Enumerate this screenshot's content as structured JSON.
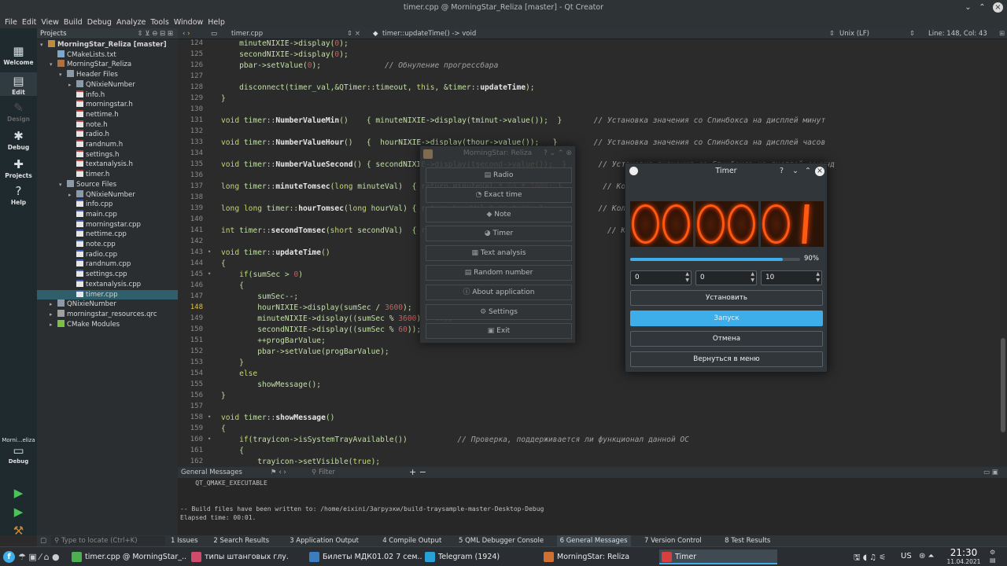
{
  "window_title": "timer.cpp @ MorningStar_Reliza [master] - Qt Creator",
  "menu": [
    "File",
    "Edit",
    "View",
    "Build",
    "Debug",
    "Analyze",
    "Tools",
    "Window",
    "Help"
  ],
  "modes": [
    {
      "label": "Welcome",
      "icon": "grid-icon"
    },
    {
      "label": "Edit",
      "icon": "edit-icon"
    },
    {
      "label": "Design",
      "icon": "pencil-icon"
    },
    {
      "label": "Debug",
      "icon": "bug-icon"
    },
    {
      "label": "Projects",
      "icon": "wrench-icon"
    },
    {
      "label": "Help",
      "icon": "help-icon"
    }
  ],
  "kit": {
    "name": "Morni...eliza",
    "mode": "Debug"
  },
  "project_panel": {
    "title": "Projects",
    "tree": [
      {
        "label": "MorningStar_Reliza [master]",
        "level": 0,
        "arrow": "▾",
        "type": "project"
      },
      {
        "label": "CMakeLists.txt",
        "level": 1,
        "arrow": "",
        "type": "file"
      },
      {
        "label": "MorningStar_Reliza",
        "level": 1,
        "arrow": "▾",
        "type": "target"
      },
      {
        "label": "Header Files",
        "level": 2,
        "arrow": "▾",
        "type": "folder"
      },
      {
        "label": "QNixieNumber",
        "level": 3,
        "arrow": "▸",
        "type": "folder"
      },
      {
        "label": "info.h",
        "level": 3,
        "arrow": "",
        "type": "h"
      },
      {
        "label": "morningstar.h",
        "level": 3,
        "arrow": "",
        "type": "h"
      },
      {
        "label": "nettime.h",
        "level": 3,
        "arrow": "",
        "type": "h"
      },
      {
        "label": "note.h",
        "level": 3,
        "arrow": "",
        "type": "h"
      },
      {
        "label": "radio.h",
        "level": 3,
        "arrow": "",
        "type": "h"
      },
      {
        "label": "randnum.h",
        "level": 3,
        "arrow": "",
        "type": "h"
      },
      {
        "label": "settings.h",
        "level": 3,
        "arrow": "",
        "type": "h"
      },
      {
        "label": "textanalysis.h",
        "level": 3,
        "arrow": "",
        "type": "h"
      },
      {
        "label": "timer.h",
        "level": 3,
        "arrow": "",
        "type": "h"
      },
      {
        "label": "Source Files",
        "level": 2,
        "arrow": "▾",
        "type": "folder"
      },
      {
        "label": "QNixieNumber",
        "level": 3,
        "arrow": "▸",
        "type": "folder"
      },
      {
        "label": "info.cpp",
        "level": 3,
        "arrow": "",
        "type": "cpp"
      },
      {
        "label": "main.cpp",
        "level": 3,
        "arrow": "",
        "type": "cpp"
      },
      {
        "label": "morningstar.cpp",
        "level": 3,
        "arrow": "",
        "type": "cpp"
      },
      {
        "label": "nettime.cpp",
        "level": 3,
        "arrow": "",
        "type": "cpp"
      },
      {
        "label": "note.cpp",
        "level": 3,
        "arrow": "",
        "type": "cpp"
      },
      {
        "label": "radio.cpp",
        "level": 3,
        "arrow": "",
        "type": "cpp"
      },
      {
        "label": "randnum.cpp",
        "level": 3,
        "arrow": "",
        "type": "cpp"
      },
      {
        "label": "settings.cpp",
        "level": 3,
        "arrow": "",
        "type": "cpp"
      },
      {
        "label": "textanalysis.cpp",
        "level": 3,
        "arrow": "",
        "type": "cpp"
      },
      {
        "label": "timer.cpp",
        "level": 3,
        "arrow": "",
        "type": "cpp",
        "selected": true
      },
      {
        "label": "QNixieNumber",
        "level": 1,
        "arrow": "▸",
        "type": "folder"
      },
      {
        "label": "morningstar_resources.qrc",
        "level": 1,
        "arrow": "▸",
        "type": "qrc"
      },
      {
        "label": "CMake Modules",
        "level": 1,
        "arrow": "▸",
        "type": "cmake"
      }
    ]
  },
  "editor": {
    "file": "timer.cpp",
    "symbol": "timer::updateTime() -> void",
    "encoding": "Unix (LF)",
    "position": "Line: 148, Col: 43"
  },
  "code_lines": [
    {
      "n": "124",
      "t": "    minuteNIXIE->display(0);"
    },
    {
      "n": "125",
      "t": "    secondNIXIE->display(0);"
    },
    {
      "n": "126",
      "t": "    pbar->setValue(0);              // Обнуление прогрессбара"
    },
    {
      "n": "127",
      "t": ""
    },
    {
      "n": "128",
      "t": "    disconnect(timer_val,&QTimer::timeout, this, &timer::updateTime);"
    },
    {
      "n": "129",
      "t": "}"
    },
    {
      "n": "130",
      "t": ""
    },
    {
      "n": "131",
      "t": "void timer::NumberValueMin()    { minuteNIXIE->display(tminut->value());  }       // Установка значения со Спинбокса на дисплей минут"
    },
    {
      "n": "132",
      "t": ""
    },
    {
      "n": "133",
      "t": "void timer::NumberValueHour()   {  hourNIXIE->display(thour->value());   }        // Установка значения со Спинбокса на дисплей часов"
    },
    {
      "n": "134",
      "t": ""
    },
    {
      "n": "135",
      "t": "void timer::NumberValueSecond() { secondNIXIE->display(tsecond->value());  }       // Установка значения со Спинбокса на дисплей секунд"
    },
    {
      "n": "136",
      "t": ""
    },
    {
      "n": "137",
      "t": "long timer::minuteTomsec(long minuteVal)  { return minuteVal * 60 * 1000; }         // Количество мсек и сек в 1 минуте"
    },
    {
      "n": "138",
      "t": ""
    },
    {
      "n": "139",
      "t": "long long timer::hourTomsec(long hourVal) { return hourVal * 60 * 60; }            // Количество мсек, сек и минут в 1 часе"
    },
    {
      "n": "140",
      "t": ""
    },
    {
      "n": "141",
      "t": "int timer::secondTomsec(short secondVal)  { return secondVal * 1000; }               // Количество мсек в 1 секунде"
    },
    {
      "n": "142",
      "t": ""
    },
    {
      "n": "143",
      "t": "void timer::updateTime()"
    },
    {
      "n": "144",
      "t": "{"
    },
    {
      "n": "145",
      "t": "    if(sumSec > 0)"
    },
    {
      "n": "146",
      "t": "    {"
    },
    {
      "n": "147",
      "t": "        sumSec--;"
    },
    {
      "n": "148",
      "t": "        hourNIXIE->display(sumSec / 3600);"
    },
    {
      "n": "149",
      "t": "        minuteNIXIE->display((sumSec % 3600) / 60);"
    },
    {
      "n": "150",
      "t": "        secondNIXIE->display((sumSec % 60));"
    },
    {
      "n": "151",
      "t": "        ++progBarValue;"
    },
    {
      "n": "152",
      "t": "        pbar->setValue(progBarValue);"
    },
    {
      "n": "153",
      "t": "    }"
    },
    {
      "n": "154",
      "t": "    else"
    },
    {
      "n": "155",
      "t": "        showMessage();"
    },
    {
      "n": "156",
      "t": "}"
    },
    {
      "n": "157",
      "t": ""
    },
    {
      "n": "158",
      "t": "void timer::showMessage()"
    },
    {
      "n": "159",
      "t": "{"
    },
    {
      "n": "160",
      "t": "    if(trayicon->isSystemTrayAvailable())           // Проверка, поддерживается ли функционал данной ОС"
    },
    {
      "n": "161",
      "t": "    {"
    },
    {
      "n": "162",
      "t": "        trayicon->setVisible(true);"
    }
  ],
  "output": {
    "title": "General Messages",
    "filter": "Filter",
    "lines": [
      "    QT_QMAKE_EXECUTABLE",
      "",
      "",
      "-- Build files have been written to: /home/eixini/Загрузки/build-traysample-master-Desktop-Debug",
      "Elapsed time: 00:01."
    ]
  },
  "bottom": {
    "locator": "Type to locate (Ctrl+K)",
    "tabs": [
      "1 Issues",
      "2 Search Results",
      "3 Application Output",
      "4 Compile Output",
      "5 QML Debugger Console",
      "6 General Messages",
      "7 Version Control",
      "8 Test Results"
    ]
  },
  "menu_window": {
    "title": "MorningStar: Reliza",
    "items": [
      "Radio",
      "Exact time",
      "Note",
      "Timer",
      "Text analysis",
      "Random number",
      "About application",
      "Settings",
      "Exit"
    ]
  },
  "timer_window": {
    "title": "Timer",
    "digits": [
      "0",
      "0",
      "0",
      "0",
      "0",
      "1"
    ],
    "progress": 0.9,
    "progress_text": "90%",
    "spin": [
      "0",
      "0",
      "10"
    ],
    "buttons": [
      "Установить",
      "Запуск",
      "Отмена",
      "Вернуться в меню"
    ],
    "accent": "#3daee9"
  },
  "taskbar": {
    "tasks": [
      "timer.cpp @ MorningStar_...",
      "типы штанговых глу...",
      "Билеты МДК01.02 7 сем....",
      "Telegram (1924)",
      "MorningStar: Reliza",
      "Timer"
    ],
    "layout": "US",
    "time": "21:30",
    "date": "11.04.2021"
  }
}
